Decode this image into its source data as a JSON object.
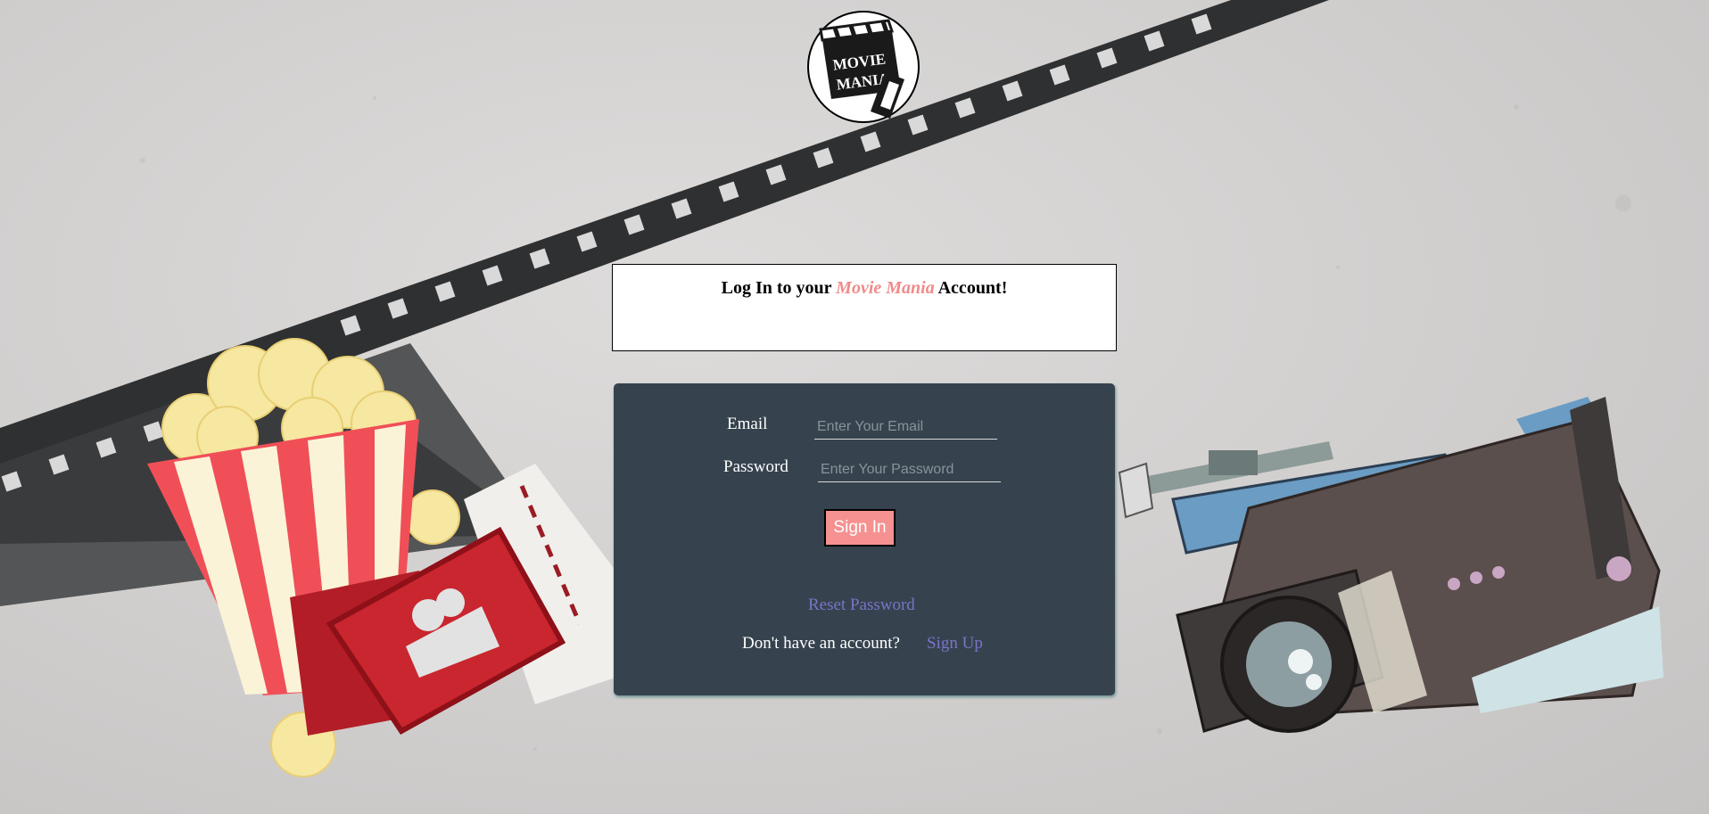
{
  "logo": {
    "line1": "MOVIE",
    "line2": "MANIA"
  },
  "header": {
    "prefix": "Log In to your ",
    "brand": "Movie Mania",
    "suffix": " Account!"
  },
  "form": {
    "email_label": "Email",
    "email_placeholder": "Enter Your Email",
    "email_value": "",
    "password_label": "Password",
    "password_placeholder": "Enter Your Password",
    "password_value": "",
    "signin_label": "Sign In",
    "reset_label": "Reset Password",
    "no_account_text": "Don't have an account?",
    "signup_label": "Sign Up"
  },
  "colors": {
    "panel": "#36434e",
    "accent": "#f69191",
    "link": "#7b73c8",
    "brand": "#f08a8a"
  },
  "decor": {
    "left": "popcorn-and-tickets-illustration",
    "right": "video-camera-illustration",
    "background": "film-strip-on-concrete"
  }
}
